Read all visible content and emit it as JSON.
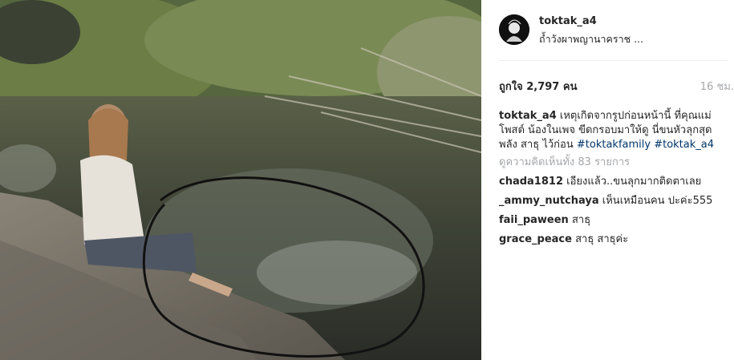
{
  "post": {
    "username": "toktak_a4",
    "location": "ถ้ำวังผาพญานาคราช ...",
    "likes": "ถูกใจ 2,797 คน",
    "time": "16 ชม."
  },
  "caption": {
    "user": "toktak_a4",
    "text": "เหตุเกิดจากรูปก่อนหน้านี้ ที่คุณแม่โพสต์ น้องในเพจ ขีดกรอบมาให้ดู นี่ขนหัวลุกสุดพลัง สาธุ ไว้ก่อน",
    "hashtags": [
      "#toktakfamily",
      "#toktak_a4"
    ]
  },
  "view_all_comments": "ดูความคิดเห็นทั้ง 83 รายการ",
  "comments": [
    {
      "user": "chada1812",
      "text": "เอียงแล้ว..ขนลุกมากติดตาเลย"
    },
    {
      "user": "_ammy_nutchaya",
      "text": "เห็นเหมือนคน ปะค่ะ555"
    },
    {
      "user": "faii_paween",
      "text": "สาธุ"
    },
    {
      "user": "grace_peace",
      "text": "สาธุ สาธุค่ะ"
    }
  ],
  "colors": {
    "hashtag": "#003569",
    "muted": "#a5a7aa",
    "text": "#262626"
  }
}
